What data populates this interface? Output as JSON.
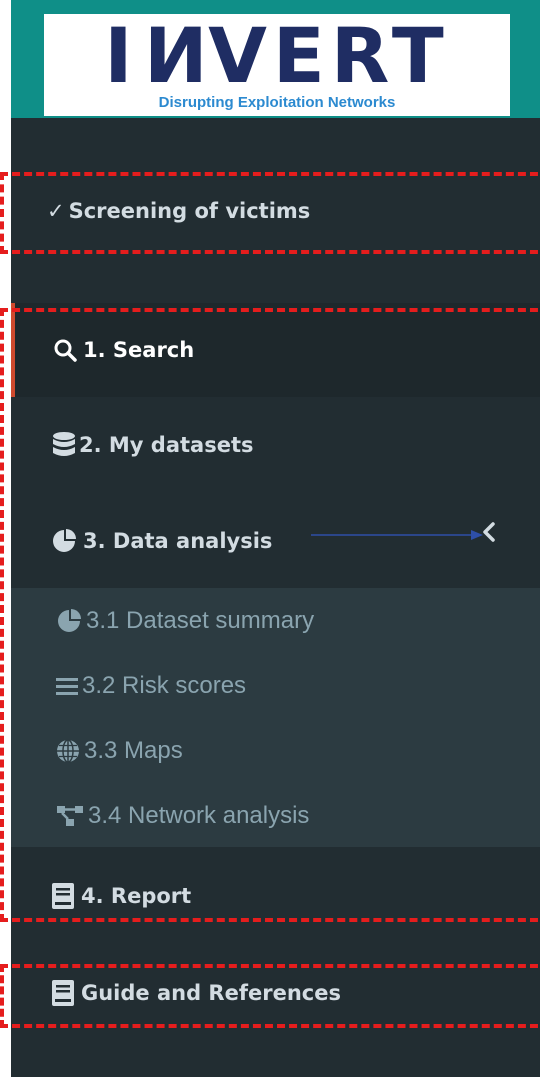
{
  "logo": {
    "word_prefix": "I",
    "word_flipped_letter": "N",
    "word_suffix": "VERT",
    "tagline": "Disrupting Exploitation Networks"
  },
  "module": {
    "check_glyph": "✓",
    "title": "Screening of victims"
  },
  "menu": {
    "search": "1. Search",
    "datasets": "2. My datasets",
    "analysis": "3. Data analysis",
    "report": "4. Report",
    "guide": "Guide and References"
  },
  "submenu": {
    "summary": "3.1 Dataset summary",
    "risk": "3.2 Risk scores",
    "maps": "3.3 Maps",
    "network": "3.4 Network analysis"
  },
  "icons": {
    "check": "check-icon",
    "search": "search-icon",
    "datasets": "database-icon",
    "analysis": "pie-chart-icon",
    "summary": "pie-chart-icon",
    "risk": "list-icon",
    "maps": "globe-icon",
    "network": "network-icon",
    "report": "book-icon",
    "guide": "book-icon",
    "expand": "chevron-left-icon"
  },
  "colors": {
    "sidebar_bg": "#222d32",
    "active_bg": "#1e282c",
    "submenu_bg": "#2c3b41",
    "accent": "#cf4a2e",
    "logo_band": "#0f8f88",
    "logo_navy": "#1f2d63",
    "logo_tagline": "#2c8ad0",
    "annotation_red": "#e51d1d",
    "text": "#d3dce2",
    "subtext": "#8aa4af"
  }
}
